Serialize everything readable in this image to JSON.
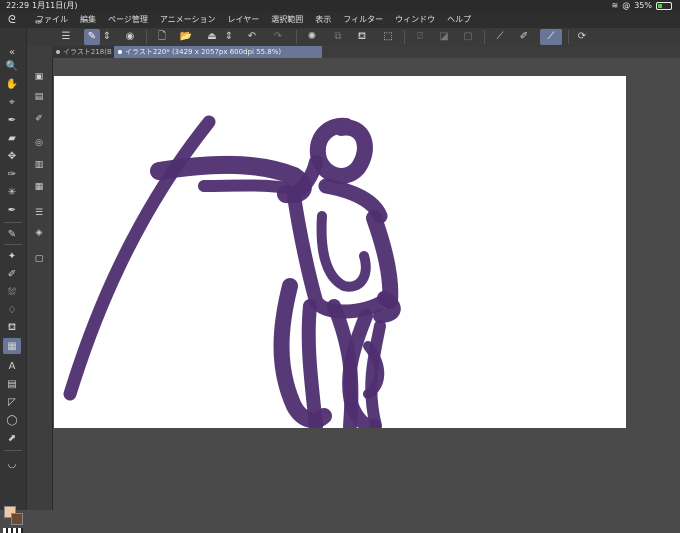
{
  "statusbar": {
    "time": "22:29",
    "date": "1月11日(月)",
    "battery_percent": "35%",
    "battery_level": 0.35
  },
  "menubar": {
    "items": [
      "ファイル",
      "編集",
      "ページ管理",
      "アニメーション",
      "レイヤー",
      "選択範囲",
      "表示",
      "フィルター",
      "ウィンドウ",
      "ヘルプ"
    ]
  },
  "tabs": [
    {
      "label": "イラスト218(B"
    },
    {
      "label": "イラスト220* (3429 x 2057px 600dpi 55.8%)"
    }
  ],
  "colors": {
    "accent": "#6a7697",
    "stroke": "#4f2e70",
    "main_color": "#f2c9a4",
    "sub_color": "#6b4a33"
  }
}
